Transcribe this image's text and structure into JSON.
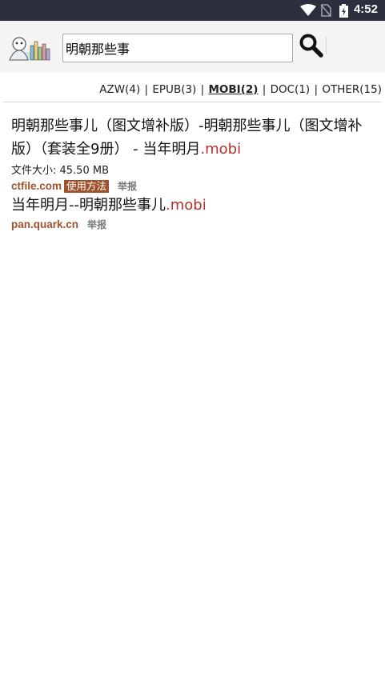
{
  "statusbar": {
    "time": "4:52"
  },
  "search": {
    "value": "明朝那些事"
  },
  "filters": [
    {
      "label": "AZW(4)",
      "active": false
    },
    {
      "label": "EPUB(3)",
      "active": false
    },
    {
      "label": "MOBI(2)",
      "active": true
    },
    {
      "label": "DOC(1)",
      "active": false
    },
    {
      "label": "OTHER(15)",
      "active": false
    }
  ],
  "filter_separator": "|",
  "results": [
    {
      "title": "明朝那些事儿（图文增补版）-明朝那些事儿（图文增补版）（套装全9册） - 当年明月",
      "ext": ".mobi",
      "size": "文件大小: 45.50 MB",
      "host": "ctfile.com",
      "howto": "使用方法",
      "report": "举报"
    },
    {
      "title": "当年明月--明朝那些事儿",
      "ext": ".mobi",
      "host": "pan.quark.cn",
      "report": "举报"
    }
  ],
  "colors": {
    "statusbar": "#2b2f3e",
    "ext": "#b5302e",
    "host": "#a0522d"
  },
  "icons": {
    "wifi": "wifi-icon",
    "no_sim": "no-sim-icon",
    "battery": "battery-charging-icon",
    "search": "search-icon",
    "logo": "app-logo-icon"
  }
}
